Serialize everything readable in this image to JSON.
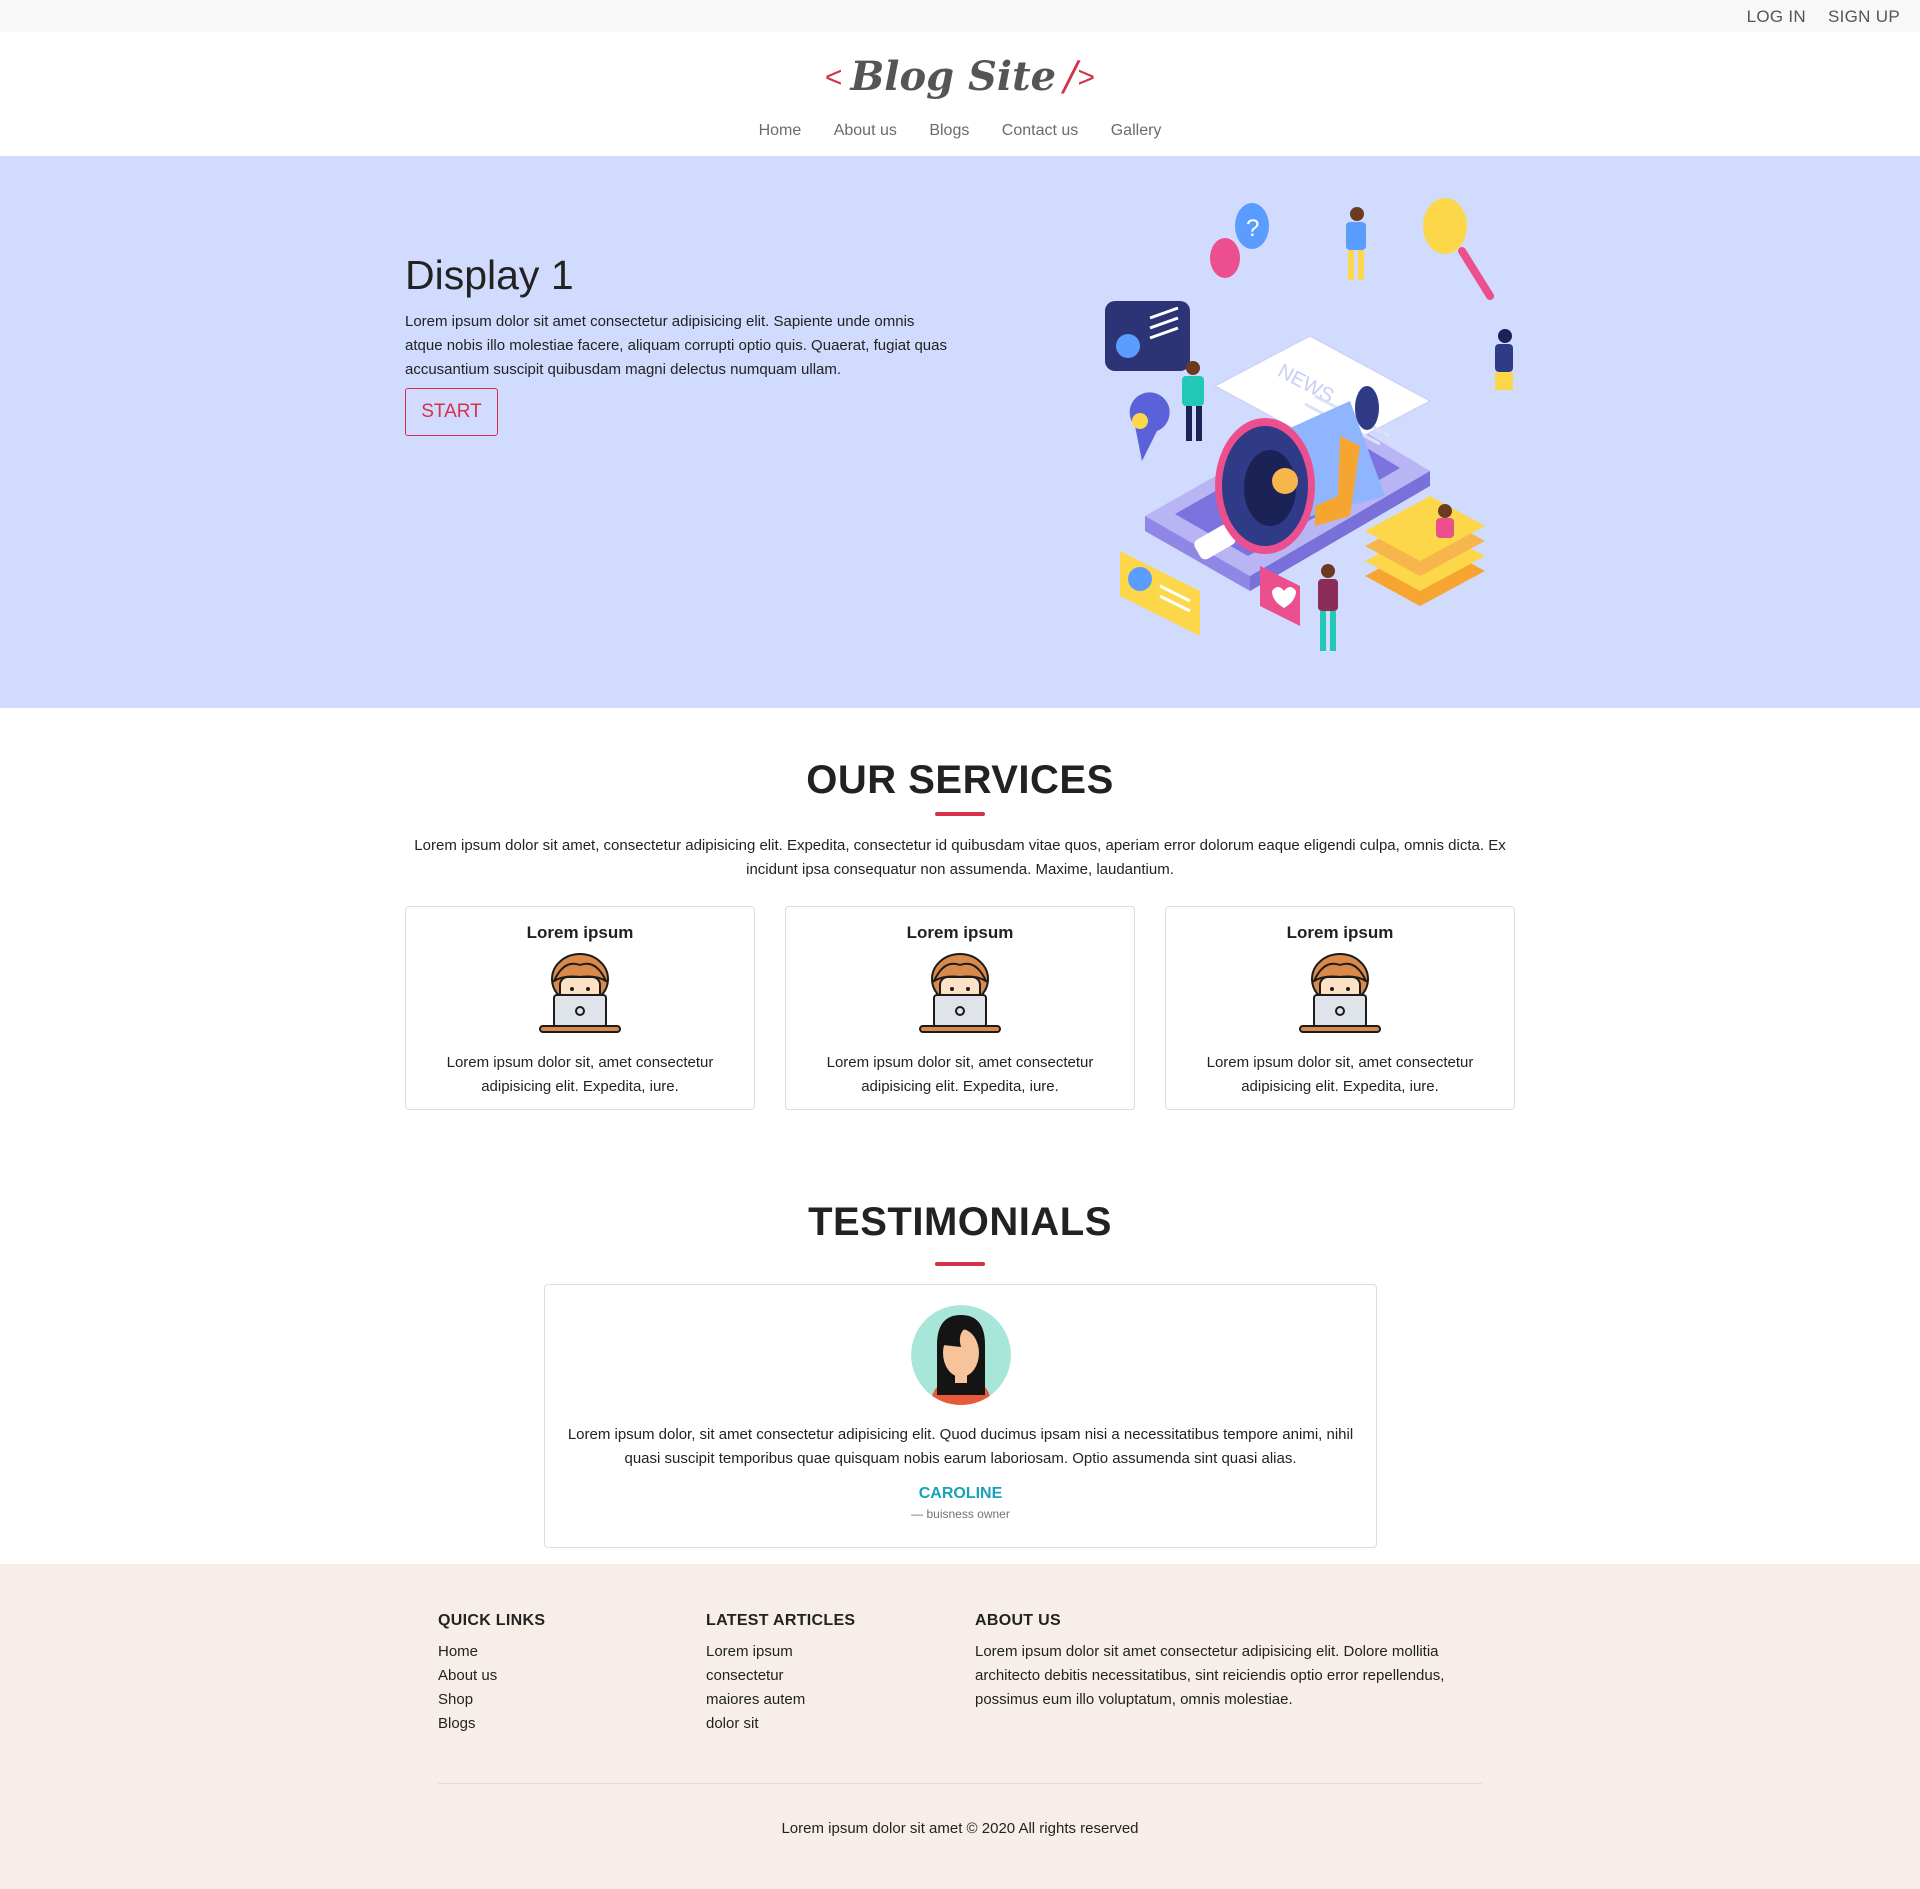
{
  "topbar": {
    "login": "LOG IN",
    "signup": "SIGN UP"
  },
  "logo": {
    "open": "<",
    "name": "Blog Site",
    "slash": "/",
    "close": ">"
  },
  "nav": [
    "Home",
    "About us",
    "Blogs",
    "Contact us",
    "Gallery"
  ],
  "hero": {
    "title": "Display 1",
    "text": "Lorem ipsum dolor sit amet consectetur adipisicing elit. Sapiente unde omnis atque nobis illo molestiae facere, aliquam corrupti optio quis. Quaerat, fugiat quas accusantium suscipit quibusdam magni delectus numquam ullam.",
    "button": "START",
    "illustration_news_text": "NEWS"
  },
  "services": {
    "title": "OUR SERVICES",
    "description": "Lorem ipsum dolor sit amet, consectetur adipisicing elit. Expedita, consectetur id quibusdam vitae quos, aperiam error dolorum eaque eligendi culpa, omnis dicta. Ex incidunt ipsa consequatur non assumenda. Maxime, laudantium.",
    "cards": [
      {
        "title": "Lorem ipsum",
        "text": "Lorem ipsum dolor sit, amet consectetur adipisicing elit. Expedita, iure."
      },
      {
        "title": "Lorem ipsum",
        "text": "Lorem ipsum dolor sit, amet consectetur adipisicing elit. Expedita, iure."
      },
      {
        "title": "Lorem ipsum",
        "text": "Lorem ipsum dolor sit, amet consectetur adipisicing elit. Expedita, iure."
      }
    ]
  },
  "testimonials": {
    "title": "TESTIMONIALS",
    "quote": "Lorem ipsum dolor, sit amet consectetur adipisicing elit. Quod ducimus ipsam nisi a necessitatibus tempore animi, nihil quasi suscipit temporibus quae quisquam nobis earum laboriosam. Optio assumenda sint quasi alias.",
    "name": "CAROLINE",
    "role": "— buisness owner"
  },
  "footer": {
    "quick_links": {
      "title": "QUICK LINKS",
      "items": [
        "Home",
        "About us",
        "Shop",
        "Blogs"
      ]
    },
    "latest_articles": {
      "title": "LATEST ARTICLES",
      "items": [
        "Lorem ipsum",
        "consectetur",
        "maiores autem",
        "dolor sit"
      ]
    },
    "about": {
      "title": "ABOUT US",
      "text": "Lorem ipsum dolor sit amet consectetur adipisicing elit. Dolore mollitia architecto debitis necessitatibus, sint reiciendis optio error repellendus, possimus eum illo voluptatum, omnis molestiae."
    },
    "copyright": "Lorem ipsum dolor sit amet © 2020 All rights reserved"
  },
  "colors": {
    "accent": "#d6304a",
    "hero_bg": "#d1dbfe",
    "footer_bg": "#f7eee9",
    "testimonial_name": "#17a2b8"
  }
}
